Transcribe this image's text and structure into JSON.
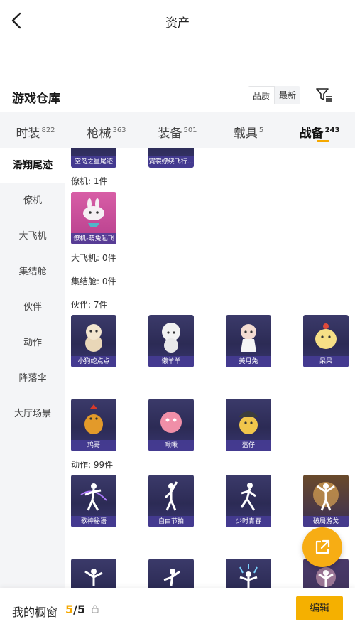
{
  "header": {
    "title": "资产"
  },
  "section": {
    "title": "游戏仓库",
    "sort_options": [
      "品质",
      "最新"
    ]
  },
  "tabs": [
    {
      "label": "时装",
      "count": "822"
    },
    {
      "label": "枪械",
      "count": "363"
    },
    {
      "label": "装备",
      "count": "501"
    },
    {
      "label": "载具",
      "count": "5"
    },
    {
      "label": "战备",
      "count": "243"
    }
  ],
  "active_tab": 4,
  "sidebar": [
    "滑翔尾迹",
    "僚机",
    "大飞机",
    "集结舱",
    "伙伴",
    "动作",
    "降落伞",
    "大厅场景"
  ],
  "groups": {
    "top_cards": [
      "空岛之星尾迹",
      "霓裳缭绕飞行..."
    ],
    "wingman": {
      "title": "僚机: 1件",
      "cards": [
        "僚机-萌兔起飞"
      ]
    },
    "big_plane": {
      "title": "大飞机: 0件"
    },
    "rally": {
      "title": "集结舱: 0件"
    },
    "partner": {
      "title": "伙伴: 7件",
      "cards": [
        "小狗蛇点点",
        "懒羊羊",
        "美月兔",
        "呆呆",
        "鸡哥",
        "啾啾",
        "盔仔"
      ]
    },
    "emote": {
      "title": "动作: 99件",
      "cards": [
        "歌神秘语",
        "自由节拍",
        "少时青春",
        "破局游戈"
      ]
    }
  },
  "bottom": {
    "window_label": "我的橱窗",
    "current": "5",
    "total": "/5",
    "edit_label": "编辑"
  },
  "colors": {
    "accent": "#f5a800",
    "card_bg": "#2c2b55"
  }
}
